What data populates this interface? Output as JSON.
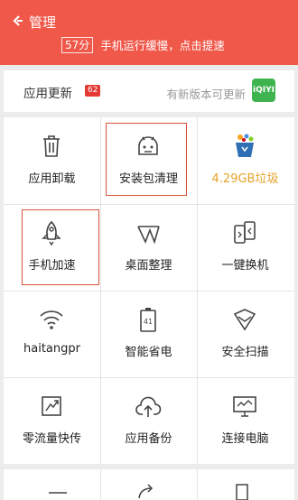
{
  "header": {
    "title": "管理",
    "score": "57分",
    "status_text": "手机运行缓慢，点击提速",
    "bg_color": "#f0584a"
  },
  "updates": {
    "label": "应用更新",
    "badge": "62",
    "hint": "有新版本可更新",
    "app_icon_text": "iQIYI"
  },
  "grid": [
    {
      "label": "应用卸载",
      "icon": "trash-icon"
    },
    {
      "label": "安装包清理",
      "icon": "android-icon",
      "highlighted": true
    },
    {
      "label": "4.29GB垃圾",
      "icon": "junk-bin-icon",
      "accent": "#e5a32a"
    },
    {
      "label": "手机加速",
      "icon": "rocket-icon",
      "highlighted": true
    },
    {
      "label": "桌面整理",
      "icon": "desktop-tidy-icon"
    },
    {
      "label": "一键换机",
      "icon": "phone-switch-icon"
    },
    {
      "label": "haitangpr",
      "icon": "wifi-icon"
    },
    {
      "label": "智能省电",
      "icon": "battery-icon",
      "value": "41"
    },
    {
      "label": "安全扫描",
      "icon": "shield-icon"
    },
    {
      "label": "零流量快传",
      "icon": "zero-traffic-icon"
    },
    {
      "label": "应用备份",
      "icon": "cloud-upload-icon"
    },
    {
      "label": "连接电脑",
      "icon": "monitor-icon"
    }
  ]
}
